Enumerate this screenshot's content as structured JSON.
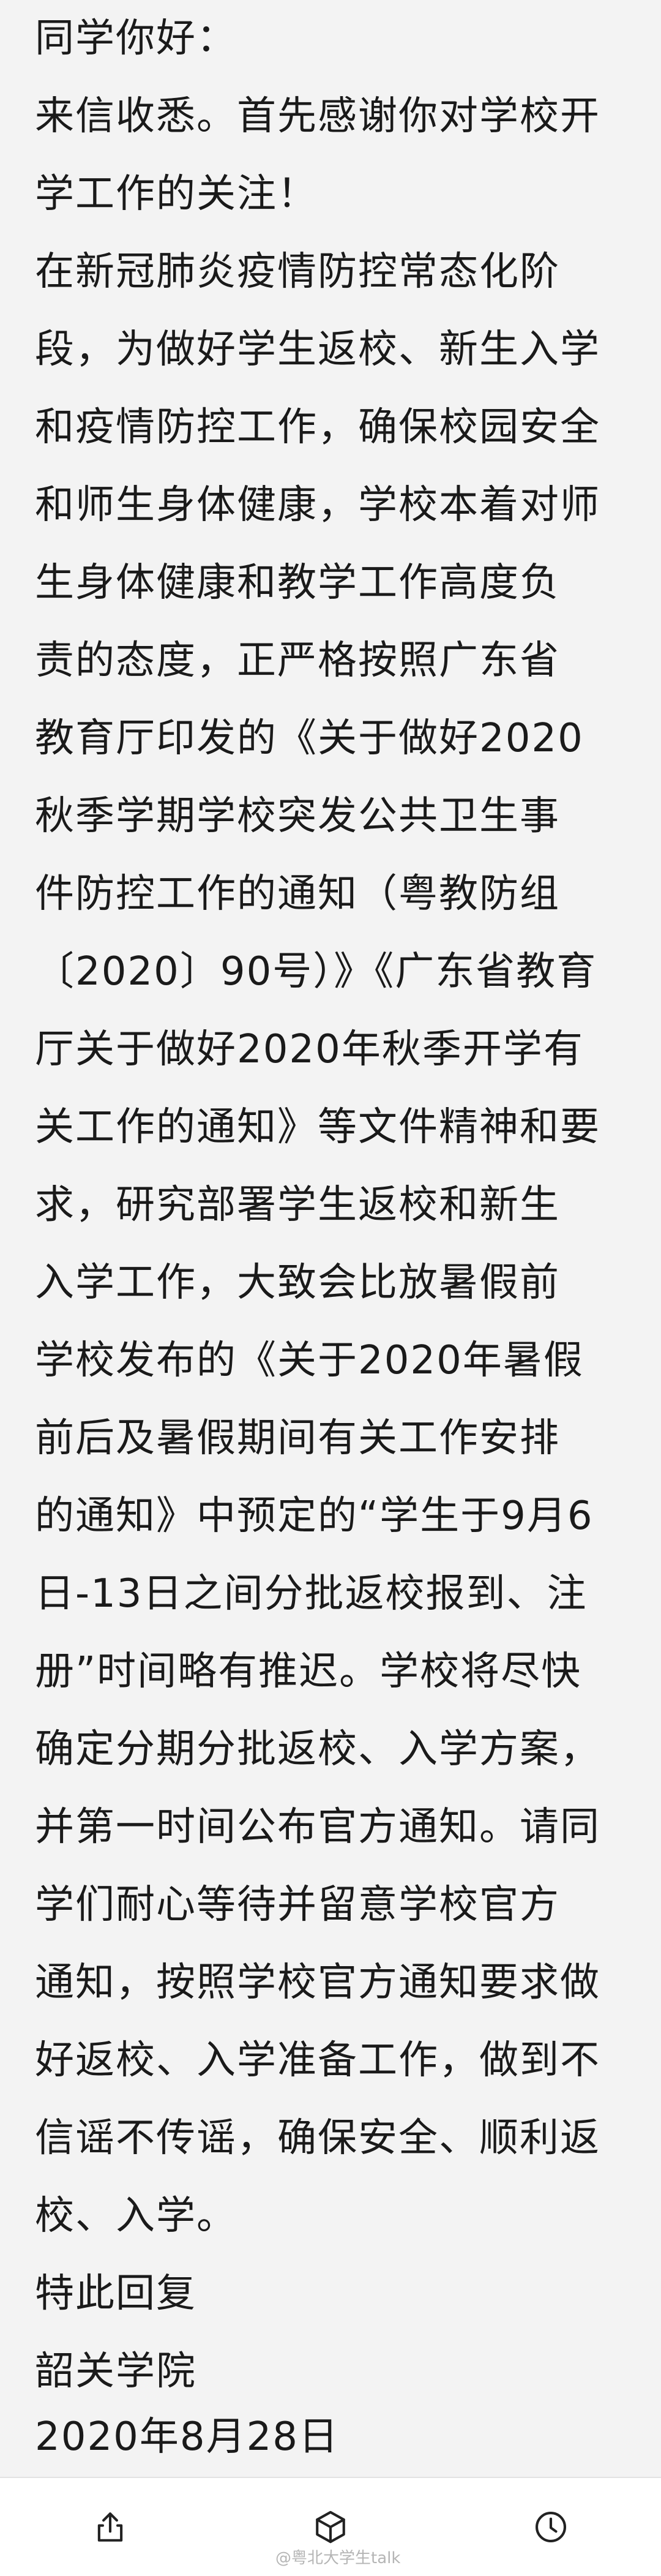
{
  "letter": {
    "greeting": "同学你好：",
    "intro_lines": [
      "来信收悉。首先感谢你对学校开",
      "学工作的关注！"
    ],
    "body_lines": [
      "在新冠肺炎疫情防控常态化阶",
      "段，为做好学生返校、新生入学",
      "和疫情防控工作，确保校园安全",
      "和师生身体健康，学校本着对师",
      "生身体健康和教学工作高度负",
      "责的态度，正严格按照广东省",
      "教育厅印发的《关于做好2020",
      "秋季学期学校突发公共卫生事",
      "件防控工作的通知（粤教防组",
      "〔2020〕90号）》《广东省教育",
      "厅关于做好2020年秋季开学有",
      "关工作的通知》等文件精神和要",
      "求，研究部署学生返校和新生",
      "入学工作，大致会比放暑假前",
      "学校发布的《关于2020年暑假",
      "前后及暑假期间有关工作安排",
      "的通知》中预定的“学生于9月6",
      "日-13日之间分批返校报到、注",
      "册”时间略有推迟。学校将尽快",
      "确定分期分批返校、入学方案，",
      "并第一时间公布官方通知。请同",
      "学们耐心等待并留意学校官方",
      "通知，按照学校官方通知要求做",
      "好返校、入学准备工作，做到不",
      "信谣不传谣，确保安全、顺利返",
      "校、入学。"
    ],
    "closing": "特此回复",
    "signature": "韶关学院",
    "date": "2020年8月28日"
  },
  "toolbar": {
    "share_icon": "share-icon",
    "box_icon": "cube-icon",
    "clock_icon": "clock-icon"
  },
  "watermark": "@粤北大学生talk"
}
